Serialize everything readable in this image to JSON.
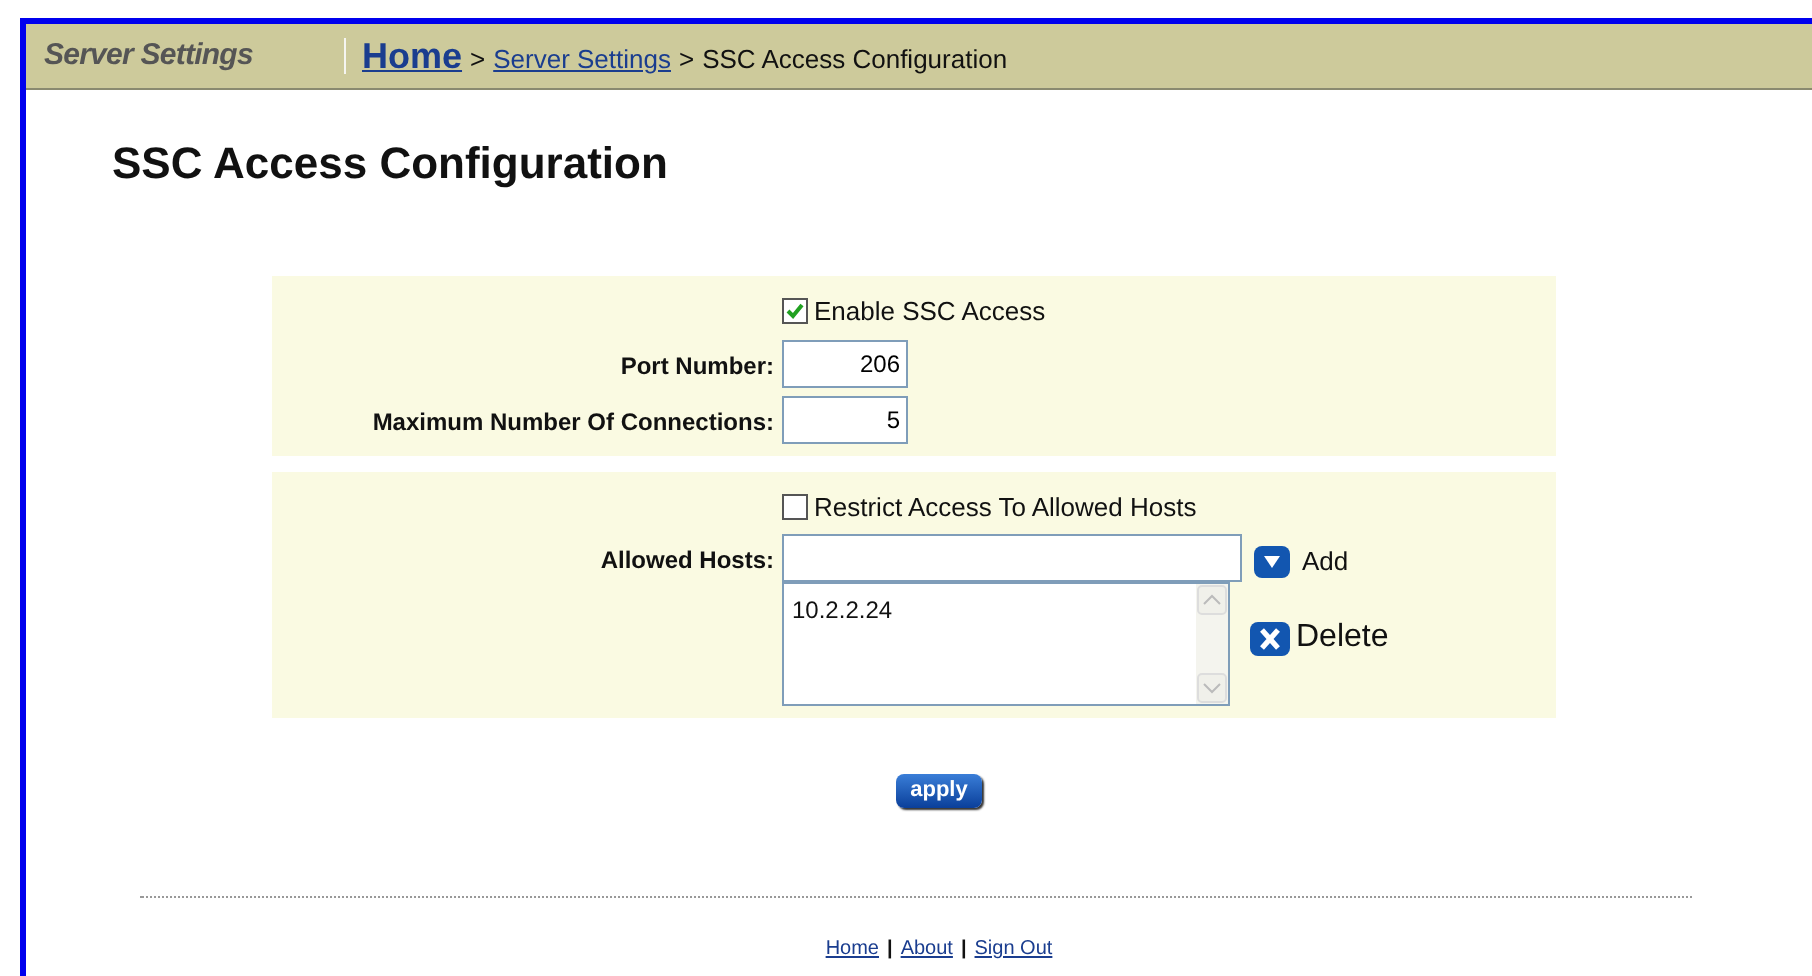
{
  "header": {
    "section": "Server Settings",
    "breadcrumb": [
      {
        "label": "Home",
        "kind": "home"
      },
      {
        "label": ">",
        "kind": "separator"
      },
      {
        "label": "Server Settings",
        "kind": "link"
      },
      {
        "label": ">",
        "kind": "separator"
      },
      {
        "label": "SSC Access Configuration",
        "kind": "current"
      }
    ]
  },
  "title": "SSC Access Configuration",
  "sections": [
    {
      "checkbox": {
        "label": "Enable SSC Access",
        "checked": true
      },
      "fields": [
        {
          "label": "Port Number:",
          "value": "206"
        },
        {
          "label": "Maximum Number Of Connections:",
          "value": "5"
        }
      ]
    },
    {
      "checkbox": {
        "label": "Restrict Access To Allowed Hosts",
        "checked": false
      },
      "hosts": {
        "label": "Allowed Hosts:",
        "add": "Add",
        "delete": "Delete",
        "items": [
          "10.2.2.24"
        ]
      }
    }
  ],
  "apply": "apply",
  "footer": {
    "links": [
      "Home",
      "About",
      "Sign Out"
    ],
    "separator": "|"
  }
}
